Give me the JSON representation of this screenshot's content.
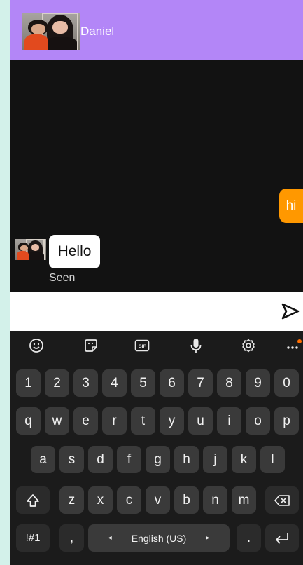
{
  "header": {
    "contact_name": "Daniel"
  },
  "chat": {
    "outgoing_text": "hi",
    "incoming_text": "Hello",
    "status": "Seen"
  },
  "composer": {
    "placeholder": ""
  },
  "keyboard": {
    "toolbar": [
      "emoji-icon",
      "sticker-icon",
      "gif-icon",
      "mic-icon",
      "settings-icon",
      "more-icon"
    ],
    "gif_label": "GIF",
    "row_numbers": [
      "1",
      "2",
      "3",
      "4",
      "5",
      "6",
      "7",
      "8",
      "9",
      "0"
    ],
    "row_top": [
      "q",
      "w",
      "e",
      "r",
      "t",
      "y",
      "u",
      "i",
      "o",
      "p"
    ],
    "row_mid": [
      "a",
      "s",
      "d",
      "f",
      "g",
      "h",
      "j",
      "k",
      "l"
    ],
    "row_bottom": [
      "z",
      "x",
      "c",
      "v",
      "b",
      "n",
      "m"
    ],
    "symbols_label": "!#1",
    "comma_label": ",",
    "space_label": "English (US)",
    "space_left_arrow": "◂",
    "space_right_arrow": "▸",
    "period_label": "."
  },
  "colors": {
    "header": "#b386f7",
    "outgoing_bubble": "#ff9800",
    "background": "#121212",
    "more_dot": "#ff6d00"
  }
}
